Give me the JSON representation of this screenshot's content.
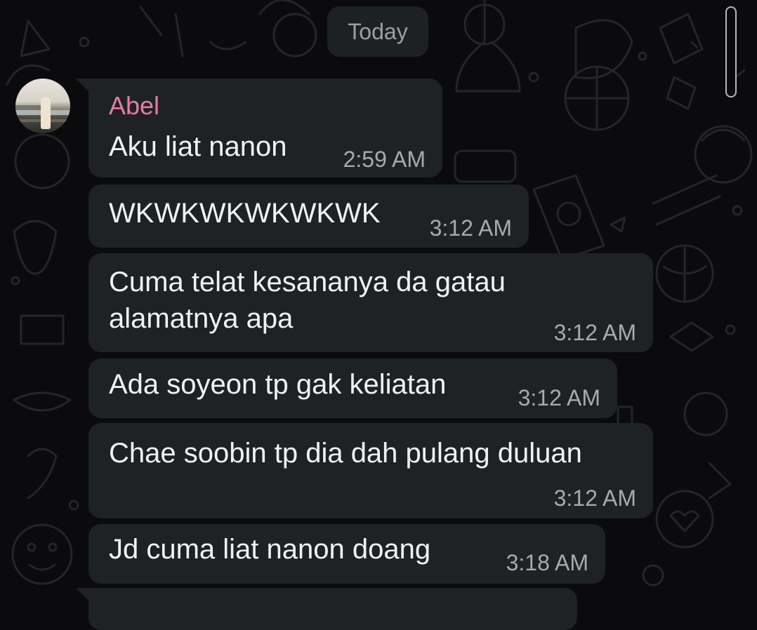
{
  "date_divider": "Today",
  "sender": {
    "name": "Abel",
    "name_color": "#e87aa5"
  },
  "messages": [
    {
      "lines": [
        "Aku liat nanon"
      ],
      "time": "2:59 AM"
    },
    {
      "lines": [
        "WKWKWKWKWKWK"
      ],
      "time": "3:12 AM"
    },
    {
      "lines": [
        "Cuma telat kesananya da gatau",
        "alamatnya apa"
      ],
      "time": "3:12 AM"
    },
    {
      "lines": [
        "Ada soyeon tp gak keliatan"
      ],
      "time": "3:12 AM"
    },
    {
      "lines": [
        "Chae soobin tp dia dah pulang duluan"
      ],
      "time": "3:12 AM"
    },
    {
      "lines": [
        "Jd cuma liat nanon doang"
      ],
      "time": "3:18 AM"
    }
  ],
  "colors": {
    "background": "#0b0b0d",
    "bubble": "#1f2224",
    "date_chip": "#1e2124",
    "message_text": "#f2f2f2",
    "timestamp_text": "#a6abae"
  }
}
